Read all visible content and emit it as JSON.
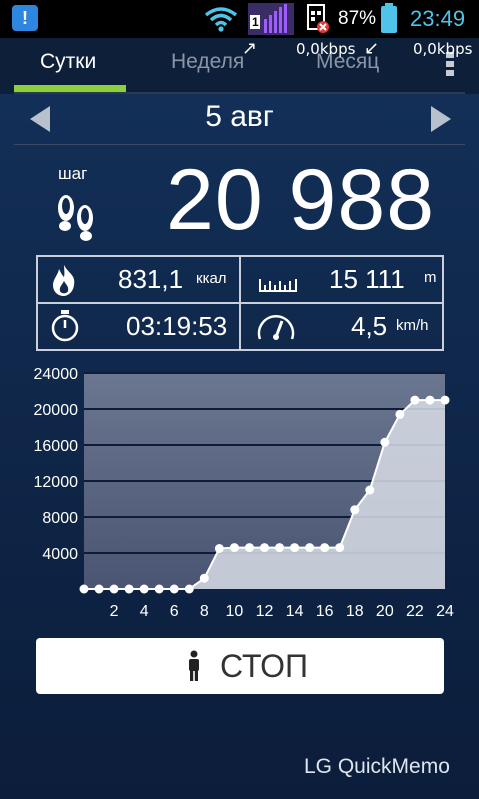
{
  "status_bar": {
    "app_icon_label": "!",
    "signal_badge": "1",
    "battery_percent": "87%",
    "time": "23:49",
    "net_up": "0,0kbps",
    "net_down": "0,0kbps"
  },
  "tabs": [
    {
      "label": "Сутки",
      "active": true
    },
    {
      "label": "Неделя",
      "active": false
    },
    {
      "label": "Месяц",
      "active": false
    }
  ],
  "date": "5 авг",
  "steps": {
    "label": "шаг",
    "value": "20 988"
  },
  "stats": {
    "calories": {
      "value": "831,1",
      "unit": "ккал"
    },
    "distance": {
      "value": "15 111",
      "unit": "m"
    },
    "duration": {
      "value": "03:19:53"
    },
    "speed": {
      "value": "4,5",
      "unit": "km/h"
    }
  },
  "chart_data": {
    "type": "area",
    "xlabel": "",
    "ylabel": "",
    "xlim": [
      0,
      24
    ],
    "ylim": [
      0,
      24000
    ],
    "x_ticks": [
      "2",
      "4",
      "6",
      "8",
      "10",
      "12",
      "14",
      "16",
      "18",
      "20",
      "22",
      "24"
    ],
    "y_ticks": [
      "4000",
      "8000",
      "12000",
      "16000",
      "20000",
      "24000"
    ],
    "grid": true,
    "x": [
      0,
      1,
      2,
      3,
      4,
      5,
      6,
      7,
      8,
      9,
      10,
      11,
      12,
      13,
      14,
      15,
      16,
      17,
      18,
      19,
      20,
      21,
      22,
      23,
      24
    ],
    "values": [
      0,
      0,
      0,
      0,
      0,
      0,
      0,
      0,
      1200,
      4500,
      4600,
      4600,
      4600,
      4600,
      4600,
      4600,
      4600,
      4600,
      8800,
      11000,
      16300,
      19400,
      20988,
      20988,
      20988
    ],
    "colors": {
      "fill": "#d8dde6",
      "line": "#ffffff",
      "point": "#ffffff",
      "background": "#5a6682"
    }
  },
  "stop_button": {
    "label": "СТОП"
  },
  "footer": {
    "label": "LG QuickMemo"
  }
}
